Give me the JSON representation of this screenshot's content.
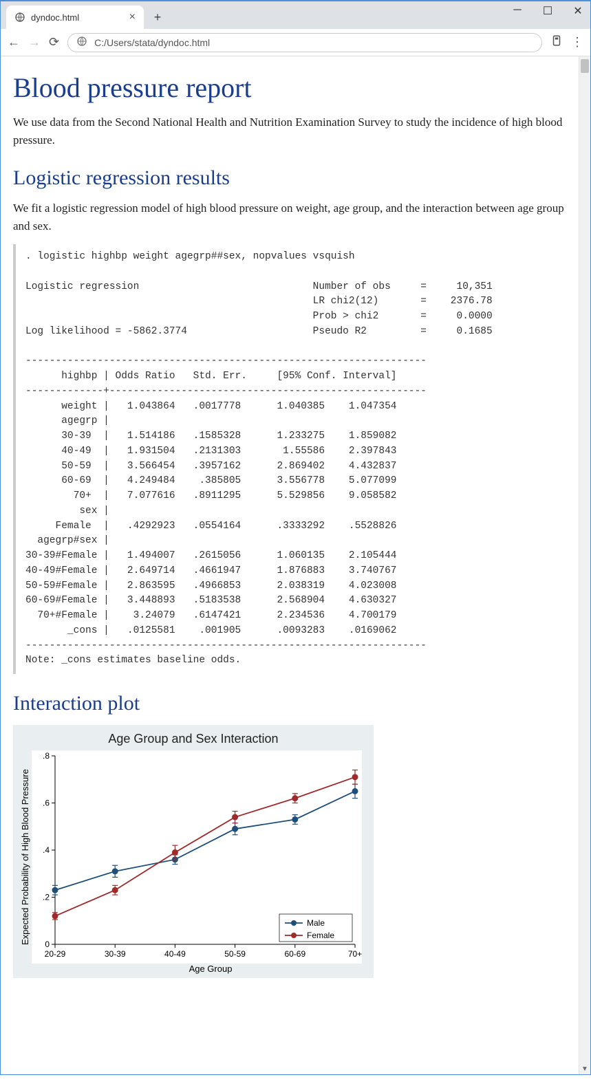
{
  "window": {
    "tab_title": "dyndoc.html",
    "url": "C:/Users/stata/dyndoc.html"
  },
  "doc": {
    "h1": "Blood pressure report",
    "intro": "We use data from the Second National Health and Nutrition Examination Survey to study the incidence of high blood pressure.",
    "h2a": "Logistic regression results",
    "p2": "We fit a logistic regression model of high blood pressure on weight, age group, and the interaction between age group and sex.",
    "h2b": "Interaction plot"
  },
  "code": ". logistic highbp weight agegrp##sex, nopvalues vsquish\n\nLogistic regression                             Number of obs     =     10,351\n                                                LR chi2(12)       =    2376.78\n                                                Prob > chi2       =     0.0000\nLog likelihood = -5862.3774                     Pseudo R2         =     0.1685\n\n-------------------------------------------------------------------\n      highbp | Odds Ratio   Std. Err.     [95% Conf. Interval]\n-------------+-----------------------------------------------------\n      weight |   1.043864   .0017778      1.040385    1.047354\n      agegrp |\n      30-39  |   1.514186   .1585328      1.233275    1.859082\n      40-49  |   1.931504   .2131303       1.55586    2.397843\n      50-59  |   3.566454   .3957162      2.869402    4.432837\n      60-69  |   4.249484    .385805      3.556778    5.077099\n        70+  |   7.077616   .8911295      5.529856    9.058582\n         sex |\n     Female  |   .4292923   .0554164      .3333292    .5528826\n  agegrp#sex |\n30-39#Female |   1.494007   .2615056      1.060135    2.105444\n40-49#Female |   2.649714   .4661947      1.876883    3.740767\n50-59#Female |   2.863595   .4966853      2.038319    4.023008\n60-69#Female |   3.448893   .5183538      2.568904    4.630327\n  70+#Female |    3.24079   .6147421      2.234536    4.700179\n       _cons |   .0125581    .001905      .0093283    .0169062\n-------------------------------------------------------------------\nNote: _cons estimates baseline odds.",
  "chart_data": {
    "type": "line",
    "title": "Age Group and Sex Interaction",
    "xlabel": "Age Group",
    "ylabel": "Expected Probability of High Blood Pressure",
    "categories": [
      "20-29",
      "30-39",
      "40-49",
      "50-59",
      "60-69",
      "70+"
    ],
    "yticks": [
      0,
      0.2,
      0.4,
      0.6,
      0.8
    ],
    "ylim": [
      0,
      0.8
    ],
    "series": [
      {
        "name": "Male",
        "color": "#1f4e79",
        "values": [
          0.23,
          0.31,
          0.36,
          0.49,
          0.53,
          0.65
        ],
        "err": [
          0.02,
          0.025,
          0.02,
          0.025,
          0.02,
          0.03
        ]
      },
      {
        "name": "Female",
        "color": "#9e2a2b",
        "values": [
          0.12,
          0.23,
          0.39,
          0.54,
          0.62,
          0.71
        ],
        "err": [
          0.015,
          0.02,
          0.03,
          0.025,
          0.02,
          0.03
        ]
      }
    ],
    "legend_position": "bottom-right"
  }
}
